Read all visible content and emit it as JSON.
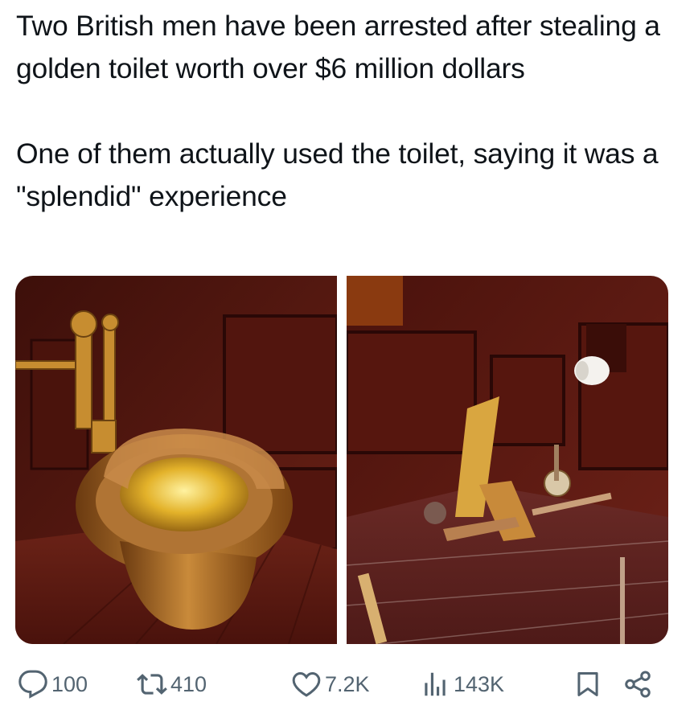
{
  "tweet": {
    "line1": "Two British men have been arrested after stealing a golden toilet worth over $6 million dollars",
    "line2": "One of them actually used the toilet, saying it was a \"splendid\" experience"
  },
  "media": {
    "left_image": "golden-toilet-photo",
    "right_image": "damaged-bathroom-photo"
  },
  "actions": {
    "replies": "100",
    "retweets": "410",
    "likes": "7.2K",
    "views": "143K"
  },
  "icons": {
    "reply": "reply-icon",
    "retweet": "retweet-icon",
    "like": "heart-icon",
    "views": "views-icon",
    "bookmark": "bookmark-icon",
    "share": "share-icon"
  },
  "colors": {
    "text": "#0f1419",
    "muted": "#536471",
    "wood": "#5a1a14",
    "gold": "#d4a020"
  }
}
